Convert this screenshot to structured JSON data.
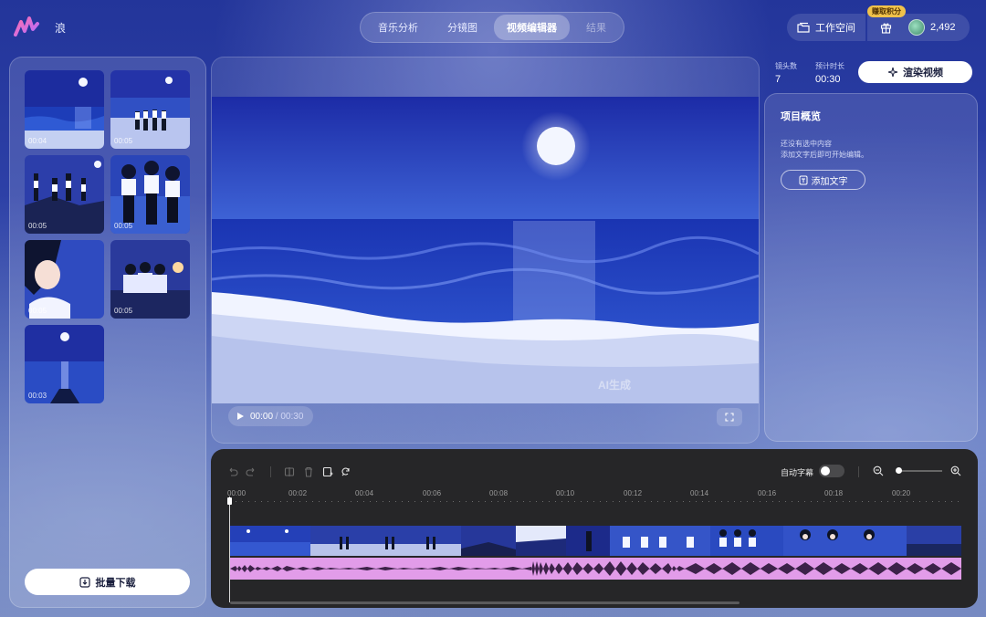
{
  "app": {
    "project_name": "浪"
  },
  "nav": {
    "tabs": [
      {
        "label": "音乐分析",
        "state": "normal"
      },
      {
        "label": "分镜图",
        "state": "normal"
      },
      {
        "label": "视频编辑器",
        "state": "active"
      },
      {
        "label": "结果",
        "state": "disabled"
      }
    ]
  },
  "header": {
    "workspace_label": "工作空间",
    "earn_points_badge": "赚取积分",
    "credits": "2,492",
    "icons": [
      "folder-icon",
      "gift-icon",
      "avatar"
    ]
  },
  "storyboard": {
    "clips": [
      {
        "duration": "00:04",
        "scene": "moon-over-sea"
      },
      {
        "duration": "00:05",
        "scene": "group-on-shore"
      },
      {
        "duration": "00:05",
        "scene": "group-on-rocks"
      },
      {
        "duration": "00:05",
        "scene": "three-girls-walking"
      },
      {
        "duration": "00:05",
        "scene": "girl-closeup"
      },
      {
        "duration": "00:05",
        "scene": "group-sitting-sunset"
      },
      {
        "duration": "00:03",
        "scene": "moon-pier"
      }
    ],
    "batch_download_label": "批量下载"
  },
  "preview": {
    "current_time": "00:00",
    "separator": " / ",
    "total_time": "00:30",
    "watermark": "AI生成"
  },
  "stats": {
    "shots_label": "镜头数",
    "shots_value": "7",
    "duration_label": "预计时长",
    "duration_value": "00:30"
  },
  "render_button_label": "渲染视频",
  "overview": {
    "title": "项目概览",
    "empty_line1": "还没有选中内容",
    "empty_line2": "添加文字后即可开始编辑。",
    "add_text_label": "添加文字"
  },
  "timeline": {
    "auto_subtitle_label": "自动字幕",
    "auto_subtitle_on": false,
    "ticks": [
      "00:00",
      "00:02",
      "00:04",
      "00:06",
      "00:08",
      "00:10",
      "00:12",
      "00:14",
      "00:16",
      "00:18",
      "00:20"
    ],
    "toolbar_icons": [
      "undo-icon",
      "redo-icon",
      "split-icon",
      "delete-icon",
      "add-clip-icon",
      "replace-icon"
    ],
    "zoom_level": 0.1,
    "colors": {
      "audio_waveform_bg": "#e29ce9",
      "timeline_bg": "#262628"
    }
  }
}
